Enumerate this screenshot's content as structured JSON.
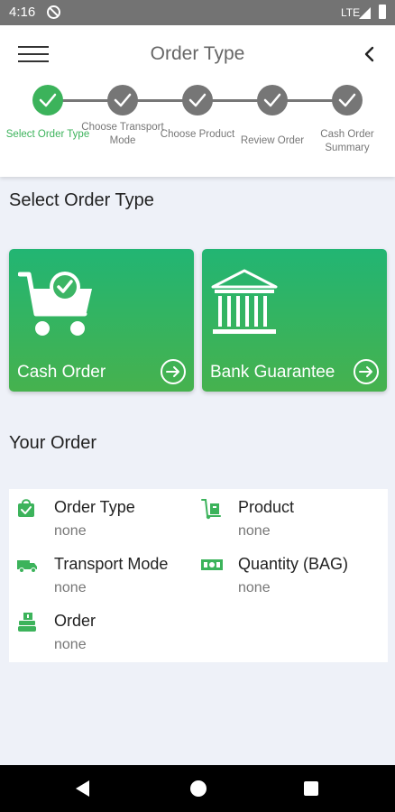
{
  "status_bar": {
    "time": "4:16",
    "network": "LTE"
  },
  "header": {
    "title": "Order Type"
  },
  "stepper": {
    "steps": [
      {
        "label": "Select Order Type",
        "active": true
      },
      {
        "label": "Choose Transport Mode",
        "active": false
      },
      {
        "label": "Choose Product",
        "active": false
      },
      {
        "label": "Review Order",
        "active": false
      },
      {
        "label": "Cash Order Summary",
        "active": false
      }
    ]
  },
  "select_section": {
    "title": "Select Order Type"
  },
  "order_types": [
    {
      "label": "Cash Order",
      "icon": "shopping-cart-check-icon"
    },
    {
      "label": "Bank Guarantee",
      "icon": "bank-icon"
    }
  ],
  "your_order": {
    "title": "Your Order",
    "items": [
      {
        "label": "Order Type",
        "value": "none",
        "icon": "shopping-bag-icon"
      },
      {
        "label": "Product",
        "value": "none",
        "icon": "hand-truck-icon"
      },
      {
        "label": "Transport Mode",
        "value": "none",
        "icon": "truck-icon"
      },
      {
        "label": "Quantity (BAG)",
        "value": "none",
        "icon": "money-icon"
      },
      {
        "label": "Order",
        "value": "none",
        "icon": "hand-box-icon"
      }
    ]
  },
  "colors": {
    "accent": "#3cb35b",
    "inactive": "#767676",
    "card_top": "#22b573",
    "card_bottom": "#46b24e"
  }
}
